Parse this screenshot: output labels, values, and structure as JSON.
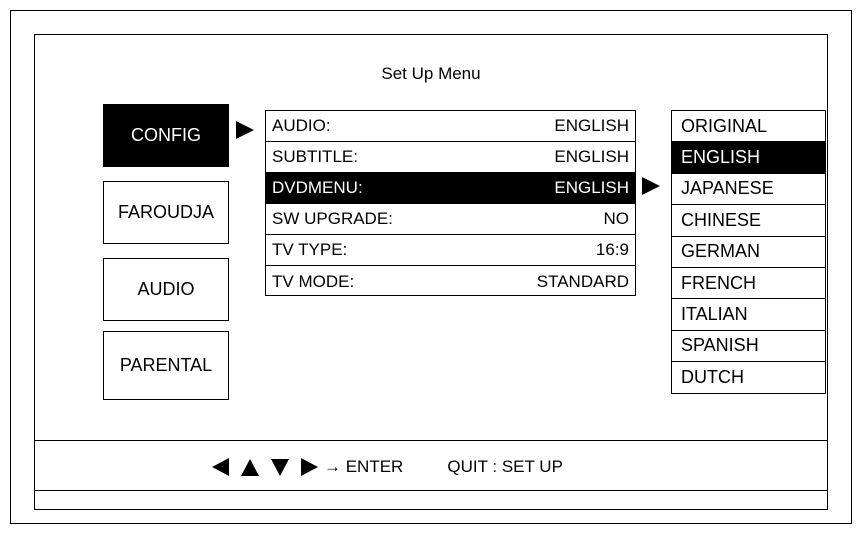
{
  "title": "Set Up Menu",
  "tabs": [
    {
      "label": "CONFIG",
      "active": true
    },
    {
      "label": "FAROUDJA",
      "active": false
    },
    {
      "label": "AUDIO",
      "active": false
    },
    {
      "label": "PARENTAL",
      "active": false
    }
  ],
  "settings": [
    {
      "label": "AUDIO:",
      "value": "ENGLISH"
    },
    {
      "label": "SUBTITLE:",
      "value": "ENGLISH"
    },
    {
      "label": "DVDMENU:",
      "value": "ENGLISH",
      "selected": true
    },
    {
      "label": "SW UPGRADE:",
      "value": "NO"
    },
    {
      "label": "TV TYPE:",
      "value": "16:9"
    },
    {
      "label": "TV MODE:",
      "value": "STANDARD"
    }
  ],
  "languages": [
    "ORIGINAL",
    "ENGLISH",
    "JAPANESE",
    "CHINESE",
    "GERMAN",
    "FRENCH",
    "ITALIAN",
    "SPANISH",
    "DUTCH"
  ],
  "selected_language": "ENGLISH",
  "footer": {
    "enter_text": "→ ENTER",
    "quit_text": "QUIT : SET UP"
  },
  "icons": {
    "left": "left-arrow-icon",
    "up": "up-arrow-icon",
    "down": "down-arrow-icon",
    "right": "right-arrow-icon"
  }
}
